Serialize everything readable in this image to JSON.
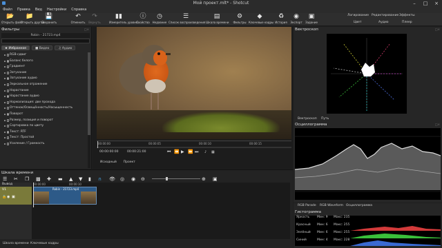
{
  "window": {
    "title": "Мой проект.mlt* - Shotcut"
  },
  "menu": [
    "Файл",
    "Правка",
    "Вид",
    "Настройки",
    "Справка"
  ],
  "toolbar": {
    "buttons": [
      {
        "label": "Открыть файл",
        "icon": "folder-open-icon"
      },
      {
        "label": "Открыть другой",
        "icon": "folder-icon"
      },
      {
        "label": "Сохранить",
        "icon": "save-icon"
      },
      {
        "label": "Отменить",
        "icon": "undo-icon"
      },
      {
        "label": "Вернуть",
        "icon": "redo-icon"
      },
      {
        "label": "Измеритель уровня",
        "icon": "audio-meter-icon"
      },
      {
        "label": "Свойства",
        "icon": "info-icon"
      },
      {
        "label": "Недавние",
        "icon": "recent-icon"
      },
      {
        "label": "Список воспроизведения",
        "icon": "playlist-icon"
      },
      {
        "label": "Шкала времени",
        "icon": "timeline-icon"
      },
      {
        "label": "Фильтры",
        "icon": "filters-icon"
      },
      {
        "label": "Ключевые кадры",
        "icon": "keyframes-icon"
      },
      {
        "label": "История",
        "icon": "history-icon"
      },
      {
        "label": "Экспорт",
        "icon": "export-icon"
      },
      {
        "label": "Задание",
        "icon": "jobs-icon"
      }
    ],
    "layouts_row1": [
      "Логирование",
      "Редактирование",
      "Эффекты"
    ],
    "layouts_row2": [
      "Цвет",
      "Аудио",
      "Плеер"
    ]
  },
  "filters": {
    "title": "Фильтры",
    "clip_name": "Robin - 21723.mp4",
    "tabs": [
      "Избранное",
      "Видео",
      "Аудио"
    ],
    "items": [
      "RGB-сдвиг",
      "Баланс белого",
      "Градиент",
      "Затухание",
      "Затухание аудио",
      "Зеркальное отражение",
      "Нарастание",
      "Нарастание аудио",
      "Нормализация: две прохода",
      "Оттенок/Освещённость/Насыщенность",
      "Поворот",
      "Размер, позиция и поворот",
      "Сортировка по цвету",
      "Текст: RTF",
      "Текст: Простой",
      "Усиление / Громкость"
    ]
  },
  "player": {
    "ruler": [
      "00:00:00",
      "00:00:05",
      "00:00:10",
      "00:00:15"
    ],
    "timecode": "00:00:00:00",
    "duration": "00:00:21:00",
    "tabs": [
      "Исходный",
      "Проект"
    ],
    "controls": [
      "skip-start-icon",
      "rewind-icon",
      "play-icon",
      "fast-forward-icon",
      "skip-end-icon"
    ]
  },
  "vectorscope": {
    "title": "Вектроскоп",
    "tabs": [
      "Вектроскоп",
      "Путь"
    ]
  },
  "waveform": {
    "title": "Осциллограмма",
    "tabs": [
      "RGB Parade",
      "RGB Waveform",
      "Осциллограмма"
    ]
  },
  "histogram": {
    "title": "Гистограмма",
    "rows": [
      {
        "name": "Яркость",
        "min": "Мин: 9",
        "max": "Макс: 235",
        "color": "#b0b0b0"
      },
      {
        "name": "Красный",
        "min": "Мин: 6",
        "max": "Макс: 255",
        "color": "#d23a3a"
      },
      {
        "name": "Зелёный",
        "min": "Мин: 6",
        "max": "Макс: 255",
        "color": "#3abf3a"
      },
      {
        "name": "Синий",
        "min": "Мин: 4",
        "max": "Макс: 228",
        "color": "#3a6ad2"
      }
    ]
  },
  "timeline": {
    "title": "Шкала времени",
    "output_label": "Вывод",
    "track_name": "V1",
    "clip_label": "Robin - 21723.mp4",
    "ruler": [
      "00:00:00",
      "00:00:10"
    ]
  },
  "status": {
    "left": "Шкала времени",
    "right": "Ключевые кадры"
  }
}
